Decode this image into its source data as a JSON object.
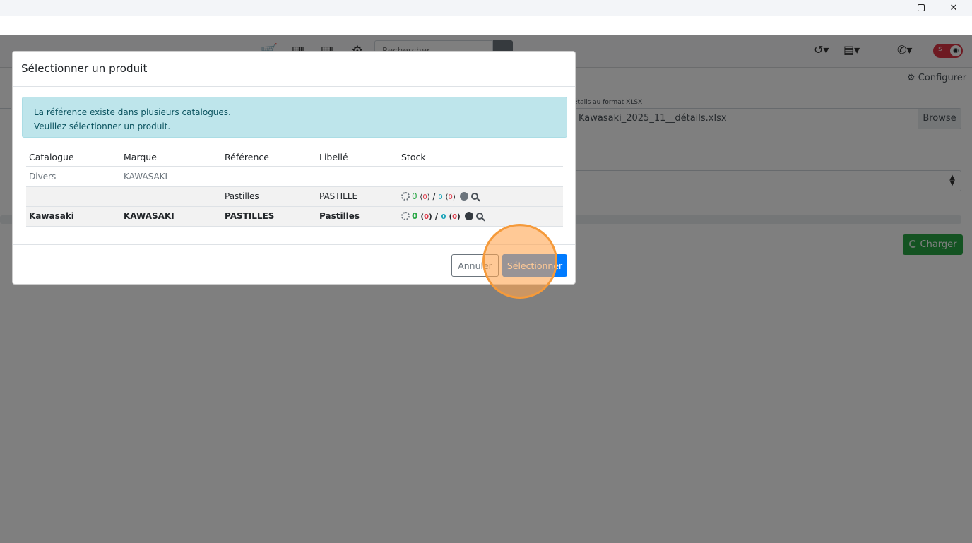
{
  "window": {
    "minimize_icon": "minimize-icon",
    "maximize_icon": "maximize-icon",
    "close_glyph": "✕"
  },
  "nav": {
    "search_placeholder": "Rechercher",
    "icons": [
      "cart-icon",
      "calendar-icon",
      "calendar-icon",
      "motorcycle-icon",
      "search-icon",
      "history-icon",
      "warehouse-icon",
      "phone-icon",
      "eye-icon"
    ],
    "toggle_symbol": "$"
  },
  "background": {
    "configure_label": "Configurer",
    "file_label": "étails au format XLSX",
    "file_name": "Kawasaki_2025_11__détails.xlsx",
    "browse_label": "Browse",
    "charger_label": "Charger"
  },
  "modal": {
    "title": "Sélectionner un produit",
    "alert_line1": "La référence existe dans plusieurs catalogues.",
    "alert_line2": "Veuillez sélectionner un produit.",
    "columns": [
      "Catalogue",
      "Marque",
      "Référence",
      "Libellé",
      "Stock"
    ],
    "rows": [
      {
        "catalogue": "Divers",
        "marque": "KAWASAKI",
        "reference": "",
        "libelle": "",
        "stock": null
      },
      {
        "catalogue": "",
        "marque": "",
        "reference": "Pastilles",
        "libelle": "PASTILLE",
        "stock": {
          "qty": "0",
          "reserved": "0",
          "ordered": "0",
          "incoming": "0",
          "slash": "/"
        }
      },
      {
        "catalogue": "Kawasaki",
        "marque": "KAWASAKI",
        "reference": "PASTILLES",
        "libelle": "Pastilles",
        "stock": {
          "qty": "0",
          "reserved": "0",
          "ordered": "0",
          "incoming": "0",
          "slash": "/"
        }
      }
    ],
    "cancel_label": "Annuler",
    "select_label": "Sélectionner"
  },
  "colors": {
    "primary": "#007bff",
    "success": "#28a745",
    "alert_bg": "#bee5eb",
    "highlight": "#f59a3a"
  }
}
